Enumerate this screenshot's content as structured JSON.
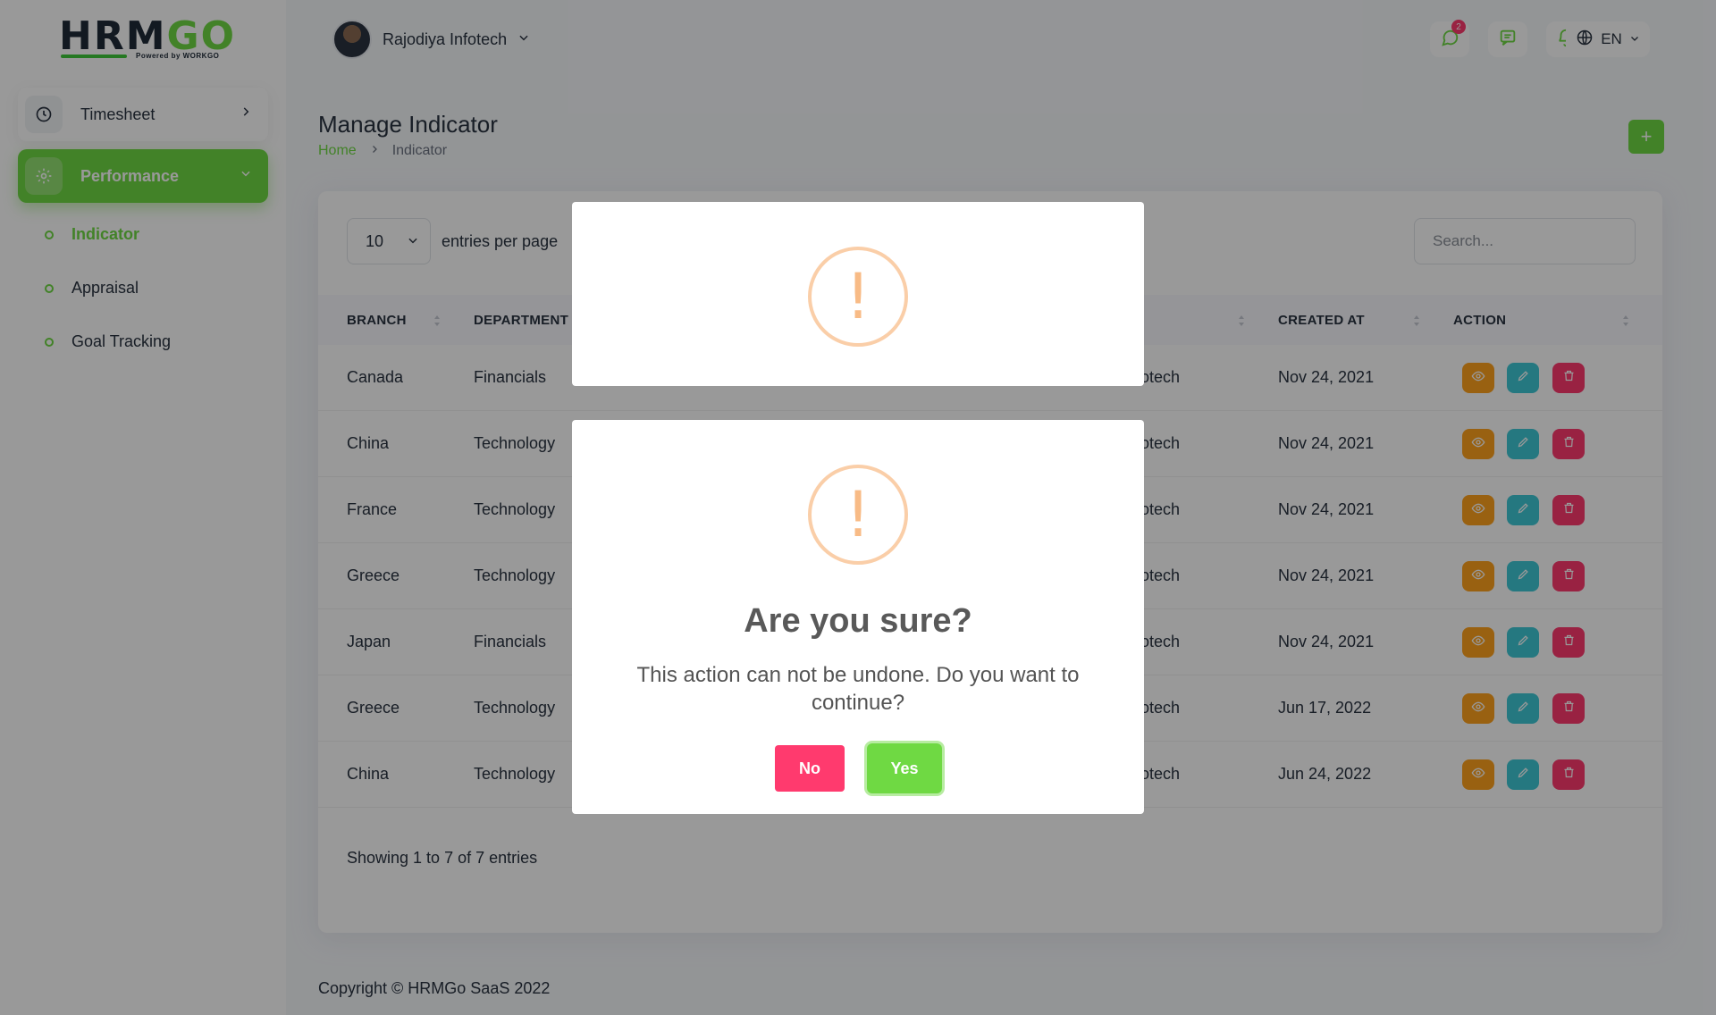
{
  "app": {
    "logo_main": "HRM",
    "logo_accent": "GO",
    "logo_sub": "Powered by WORKGO"
  },
  "sidebar": {
    "items": [
      {
        "label": "Timesheet",
        "icon": "clock-icon"
      },
      {
        "label": "Performance",
        "icon": "gear-icon",
        "active": true
      }
    ],
    "sub_items": [
      {
        "label": "Indicator",
        "active": true
      },
      {
        "label": "Appraisal"
      },
      {
        "label": "Goal Tracking"
      }
    ]
  },
  "header": {
    "company": "Rajodiya Infotech",
    "message_badge": "2",
    "language": "EN"
  },
  "page": {
    "title": "Manage Indicator",
    "breadcrumb_home": "Home",
    "breadcrumb_current": "Indicator",
    "add_label": "+"
  },
  "table": {
    "per_page_value": "10",
    "per_page_label": "entries per page",
    "search_placeholder": "Search...",
    "columns": [
      "BRANCH",
      "DEPARTMENT",
      "CREATED AT",
      "ACTION"
    ],
    "rows": [
      {
        "branch": "Canada",
        "department": "Financials",
        "partial": "otech",
        "created": "Nov 24, 2021"
      },
      {
        "branch": "China",
        "department": "Technology",
        "partial": "otech",
        "created": "Nov 24, 2021"
      },
      {
        "branch": "France",
        "department": "Technology",
        "partial": "otech",
        "created": "Nov 24, 2021"
      },
      {
        "branch": "Greece",
        "department": "Technology",
        "partial": "otech",
        "created": "Nov 24, 2021"
      },
      {
        "branch": "Japan",
        "department": "Financials",
        "partial": "otech",
        "created": "Nov 24, 2021"
      },
      {
        "branch": "Greece",
        "department": "Technology",
        "partial": "otech",
        "created": "Jun 17, 2022"
      },
      {
        "branch": "China",
        "department": "Technology",
        "partial": "otech",
        "created": "Jun 24, 2022"
      }
    ],
    "showing": "Showing 1 to 7 of 7 entries"
  },
  "footer": {
    "copyright": "Copyright © HRMGo SaaS 2022"
  },
  "modal": {
    "icon_glyph": "!",
    "title": "Are you sure?",
    "text": "This action can not be undone. Do you want to continue?",
    "no_label": "No",
    "yes_label": "Yes"
  },
  "colors": {
    "primary": "#6fd943",
    "danger": "#ff3a6e",
    "warning": "#ffa21d",
    "info": "#3ec9d6",
    "warn_icon": "#f8bb86"
  }
}
